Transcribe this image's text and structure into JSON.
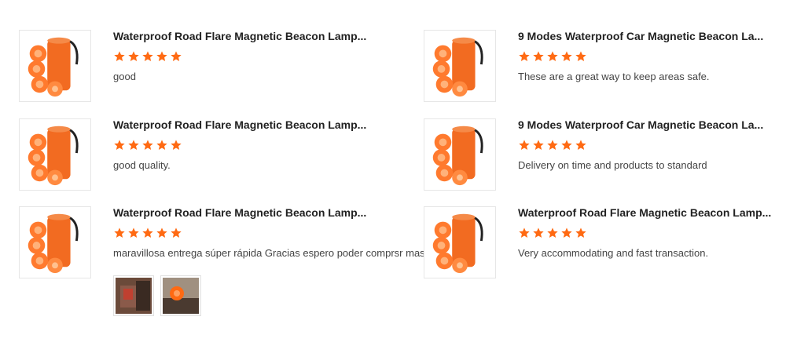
{
  "accent_color": "#ff6a13",
  "reviews": [
    {
      "title": "Waterproof Road Flare Magnetic Beacon Lamp...",
      "rating": 5,
      "text": "good"
    },
    {
      "title": "9 Modes Waterproof Car Magnetic Beacon La...",
      "rating": 5,
      "text": "These are a great way to keep areas safe."
    },
    {
      "title": "Waterproof Road Flare Magnetic Beacon Lamp...",
      "rating": 5,
      "text": "good quality."
    },
    {
      "title": "9 Modes Waterproof Car Magnetic Beacon La...",
      "rating": 5,
      "text": "Delivery on time and products to standard"
    },
    {
      "title": "Waterproof Road Flare Magnetic Beacon Lamp...",
      "rating": 5,
      "text": "maravillosa entrega súper rápida Gracias espero poder comprsr mas",
      "photos": [
        "review-photo-1",
        "review-photo-2"
      ]
    },
    {
      "title": "Waterproof Road Flare Magnetic Beacon Lamp...",
      "rating": 5,
      "text": "Very accommodating and fast transaction."
    }
  ]
}
